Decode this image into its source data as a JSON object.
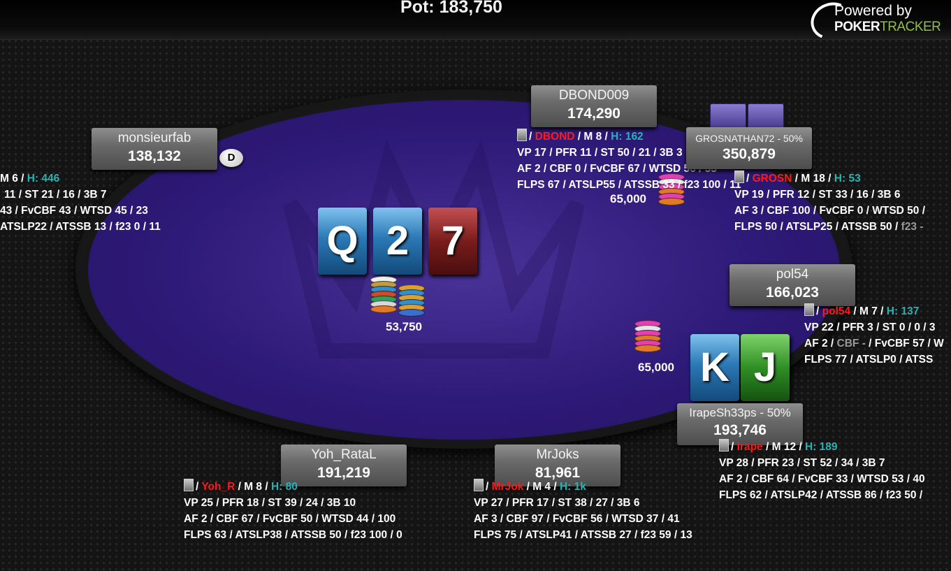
{
  "pot_label": "Pot: 183,750",
  "logo": {
    "line1": "Powered by",
    "brand_a": "P",
    "brand_b": "OKER",
    "brand_c": "TRACKER"
  },
  "board": [
    "Q",
    "2",
    "7"
  ],
  "pot_chips_amount": "53,750",
  "dealer_label": "D",
  "hero_cards": [
    "K",
    "J"
  ],
  "bets": [
    {
      "amount": "65,000"
    },
    {
      "amount": "65,000"
    }
  ],
  "players": [
    {
      "name": "monsieurfab",
      "stack": "138,132",
      "hud": {
        "l1": {
          "tag": "",
          "m": "M 6",
          "h": "H: 446"
        },
        "l2": "11 / ST 21 / 16 / 3B 7",
        "l3": "43 / FvCBF 43 / WTSD 45 / 23",
        "l4": "ATSLP22 / ATSSB 13 / f23 0 / 11"
      }
    },
    {
      "name": "DBOND009",
      "stack": "174,290",
      "hud": {
        "l1": {
          "tag": "DBOND",
          "m": "M 8",
          "h": "H: 162"
        },
        "l2": "VP 17 / PFR 11 / ST 50 / 21 / 3B 3",
        "l3": "AF 2 / CBF 0 / FvCBF 67 / WTSD 56 / 33",
        "l4": "FLPS 67 / ATSLP55 / ATSSB 33 / f23 100 / 11"
      }
    },
    {
      "name": "GROSNATHAN72 - 50%",
      "stack": "350,879",
      "hud": {
        "l1": {
          "tag": "GROSN",
          "m": "M 18",
          "h": "H: 53"
        },
        "l2": "VP 19 / PFR 12 / ST 33 / 16 / 3B 6",
        "l3": "AF 3 / CBF 100 / FvCBF 0 / WTSD 50 /",
        "l4a": "FLPS 50 / ATSLP25 / ATSSB 50 / ",
        "l4b": "f23 -"
      }
    },
    {
      "name": "pol54",
      "stack": "166,023",
      "hud": {
        "l1": {
          "tag": "pol54",
          "m": "M 7",
          "h": "H: 137"
        },
        "l2": "VP 22 / PFR 3 / ST 0 / 0 / 3",
        "l3a": "AF 2 / ",
        "l3b": "CBF -",
        "l3c": " / FvCBF 57 / W",
        "l4": "FLPS 77 / ATSLP0 / ATSS"
      }
    },
    {
      "name": "IrapeSh33ps - 50%",
      "stack": "193,746",
      "hud": {
        "l1": {
          "tag": "Irape",
          "m": "M 12",
          "h": "H: 189"
        },
        "l2": "VP 28 / PFR 23 / ST 52 / 34 / 3B 7",
        "l3": "AF 2 / CBF 64 / FvCBF 33 / WTSD 53 / 40",
        "l4": "FLPS 62 / ATSLP42 / ATSSB 86 / f23 50 /"
      }
    },
    {
      "name": "MrJoks",
      "stack": "81,961",
      "hud": {
        "l1": {
          "tag": "MrJok",
          "m": "M 4",
          "h": "H: 1k"
        },
        "l2": "VP 27 / PFR 17 / ST 38 / 27 / 3B 6",
        "l3": "AF 3 / CBF 97 / FvCBF 56 / WTSD 37 / 41",
        "l4": "FLPS 75 / ATSLP41 / ATSSB 27 / f23 59 / 13"
      }
    },
    {
      "name": "Yoh_RataL",
      "stack": "191,219",
      "hud": {
        "l1": {
          "tag": "Yoh_R",
          "m": "M 8",
          "h": "H: 80"
        },
        "l2": "VP 25 / PFR 18 / ST 39 / 24 / 3B 10",
        "l3": "AF 2 / CBF 67 / FvCBF 50 / WTSD 44 / 100",
        "l4": "FLPS 63 / ATSLP38 / ATSSB 50 / f23 100 / 0"
      }
    }
  ]
}
